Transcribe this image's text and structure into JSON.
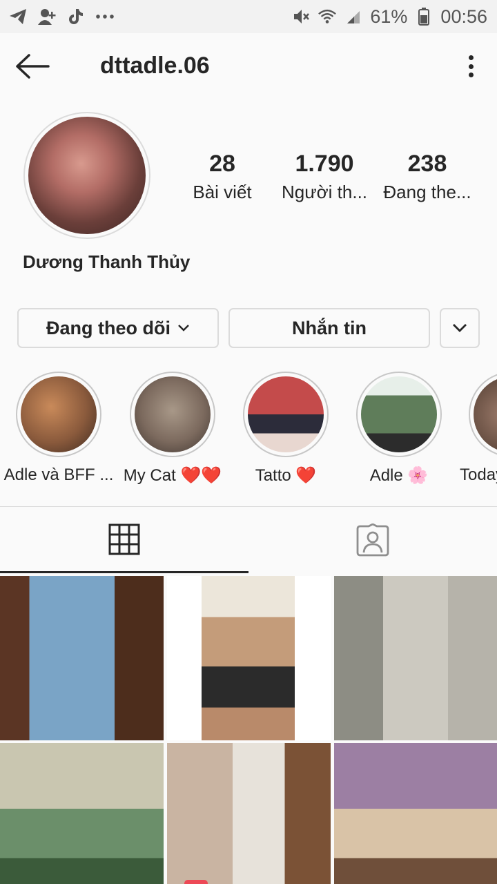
{
  "status_bar": {
    "battery": "61%",
    "time": "00:56",
    "left_icons": [
      "telegram-icon",
      "add-contact-icon",
      "tiktok-icon",
      "more-notifications-icon"
    ],
    "right_icons": [
      "mute-icon",
      "wifi-icon",
      "signal-icon",
      "battery-icon"
    ]
  },
  "header": {
    "username": "dttadle.06"
  },
  "profile": {
    "display_name": "Dương Thanh Thủy",
    "stats": [
      {
        "value": "28",
        "label": "Bài viết"
      },
      {
        "value": "1.790",
        "label": "Người th..."
      },
      {
        "value": "238",
        "label": "Đang the..."
      }
    ]
  },
  "actions": {
    "following_label": "Đang theo dõi",
    "message_label": "Nhắn tin"
  },
  "highlights": [
    {
      "label": "Adle và BFF ...",
      "color": "#8a5a3c"
    },
    {
      "label": "My Cat ❤️❤️",
      "color": "#7c6a5e"
    },
    {
      "label": "Tatto ❤️",
      "color": "#9b3b3b"
    },
    {
      "label": "Adle 🌸",
      "color": "#5f7d5a"
    },
    {
      "label": "Today",
      "color": "#6a5144"
    }
  ],
  "grid": {
    "like_badge_count": "1"
  },
  "colors": {
    "like_badge": "#ed4956",
    "text": "#262626",
    "border": "#dbdbdb"
  }
}
